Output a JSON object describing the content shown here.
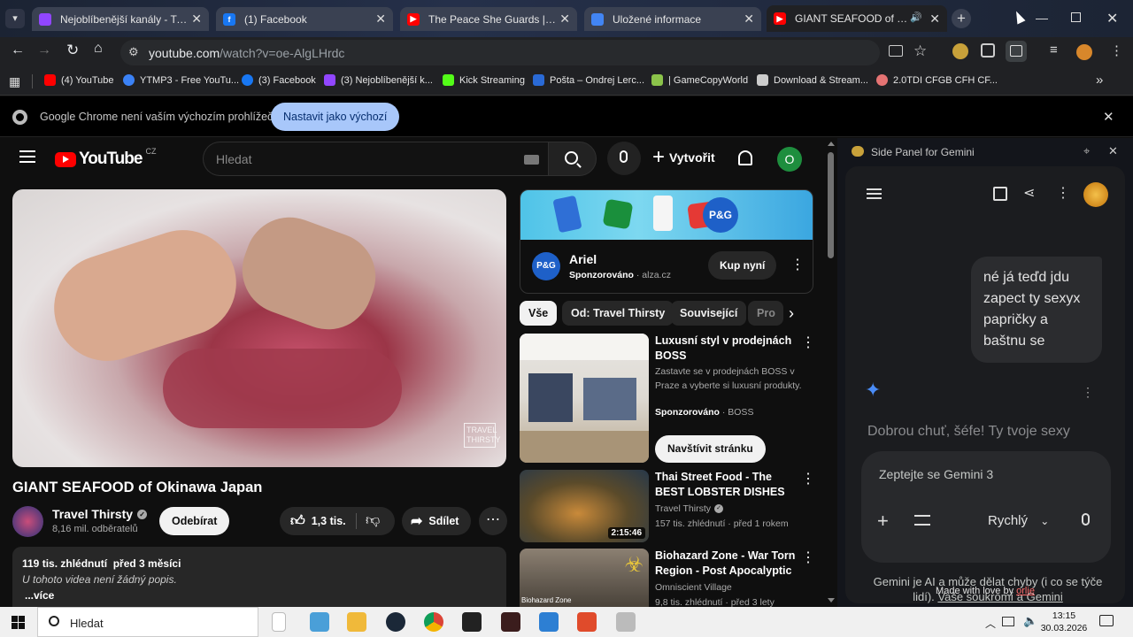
{
  "browser": {
    "tabs": [
      {
        "title": "Nejoblíbenější kanály - Twitch",
        "color": "#9146ff"
      },
      {
        "title": "(1) Facebook",
        "color": "#1877f2"
      },
      {
        "title": "The Peace She Guards | Ambien",
        "color": "#ff0000"
      },
      {
        "title": "Uložené informace",
        "color": "#4285f4"
      },
      {
        "title": "GIANT SEAFOOD of Okinaw",
        "color": "#ff0000"
      }
    ],
    "url_host": "youtube.com",
    "url_path": "/watch?v=oe-AlgLHrdc",
    "bookmarks": [
      {
        "label": "(4) YouTube",
        "color": "#ff0000"
      },
      {
        "label": "YTMP3 - Free YouTu...",
        "color": "#3b82f6"
      },
      {
        "label": "(3) Facebook",
        "color": "#1877f2"
      },
      {
        "label": "(3) Nejoblíbenější k...",
        "color": "#9146ff"
      },
      {
        "label": "Kick Streaming",
        "color": "#53fc18"
      },
      {
        "label": "Pošta – Ondrej Lerc...",
        "color": "#2a6ad6"
      },
      {
        "label": "| GameCopyWorld",
        "color": "#8bc34a"
      },
      {
        "label": "Download & Stream...",
        "color": "#cccccc"
      },
      {
        "label": "2.0TDI CFGB CFH CF...",
        "color": "#e57373"
      }
    ],
    "infobar": {
      "text": "Google Chrome není vaším výchozím prohlížečem",
      "button": "Nastavit jako výchozí"
    }
  },
  "youtube": {
    "logo": "YouTube",
    "logo_country": "CZ",
    "search_placeholder": "Hledat",
    "create_label": "Vytvořit",
    "avatar_letter": "O",
    "video": {
      "title": "GIANT SEAFOOD of Okinawa Japan",
      "watermark": "TRAVEL THIRSTY",
      "channel": "Travel Thirsty",
      "subscribers": "8,16 mil. odběratelů",
      "subscribe": "Odebírat",
      "likes": "1,3 tis.",
      "share": "Sdílet",
      "views": "119 tis. zhlédnutí",
      "age": "před 3 měsíci",
      "description": "U tohoto videa není žádný popis.",
      "more": "...více"
    },
    "ad": {
      "brand_badge": "P&G",
      "title": "Ariel",
      "sponsored": "Sponzorováno",
      "domain": "alza.cz",
      "cta": "Kup nyní"
    },
    "chips": [
      "Vše",
      "Od: Travel Thirsty",
      "Související",
      "Pro"
    ],
    "recommendations": [
      {
        "title": "Luxusní styl v prodejnách BOSS",
        "desc": "Zastavte se v prodejnách BOSS v Praze a vyberte si luxusní produkty.",
        "sponsored": "Sponzorováno",
        "source": "BOSS",
        "cta": "Navštívit stránku"
      },
      {
        "title": "Thai Street Food - The BEST LOBSTER DISHES in ...",
        "channel": "Travel Thirsty",
        "meta": "157 tis. zhlédnutí · před 1 rokem",
        "duration": "2:15:46"
      },
      {
        "title": "Biohazard Zone - War Torn Region - Post Apocalyptic ...",
        "channel": "Omniscient Village",
        "meta": "9,8 tis. zhlédnutí · před 3 lety",
        "thumb_label": "Biohazard Zone"
      }
    ]
  },
  "gemini": {
    "panel_title": "Side Panel for Gemini",
    "user_message": "né já teďd jdu zapect ty sexyx papričky a baštnu se",
    "reply": "Dobrou chuť, šéfe! Ty tvoje sexy",
    "input_placeholder": "Zeptejte se Gemini 3",
    "mode": "Rychlý",
    "disclaimer": "Gemini je AI a může dělat chyby (i co se týče lidí).",
    "privacy_link": "Vaše soukromí a Gemini",
    "made_with": "Made with love by",
    "author": "orlie"
  },
  "taskbar": {
    "search": "Hledat",
    "time": "13:15",
    "date": "30.03.2026"
  }
}
